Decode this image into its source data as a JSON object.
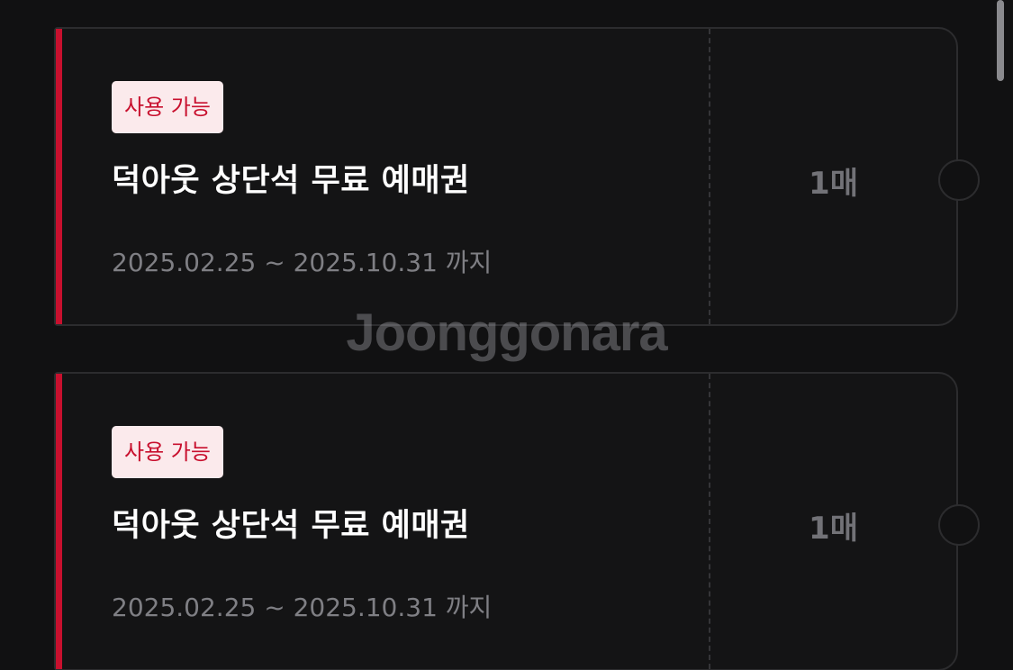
{
  "tickets": [
    {
      "badge": "사용 가능",
      "title": "덕아웃 상단석 무료 예매권",
      "period": "2025.02.25 ~ 2025.10.31 까지",
      "count": "1매"
    },
    {
      "badge": "사용 가능",
      "title": "덕아웃 상단석 무료 예매권",
      "period": "2025.02.25 ~ 2025.10.31 까지",
      "count": "1매"
    }
  ],
  "watermark": "Joonggonara",
  "colors": {
    "accent": "#c8102e",
    "background": "#111112",
    "badge_bg": "#fbeaec"
  }
}
